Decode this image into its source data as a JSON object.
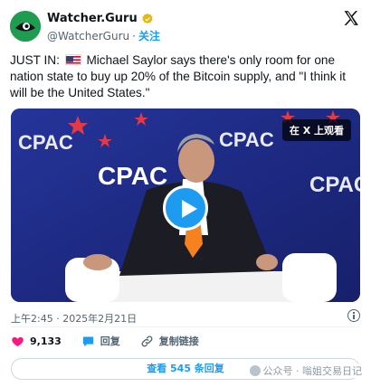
{
  "header": {
    "author_name": "Watcher.Guru",
    "handle": "@WatcherGuru",
    "separator": "·",
    "follow_label": "关注"
  },
  "tweet": {
    "prefix": "JUST IN:",
    "body": "Michael Saylor says there's only room for one nation state to buy up 20% of the Bitcoin supply, and \"I think it will be the United States.\""
  },
  "media": {
    "watch_badge": "在 X 上观看",
    "backdrop_text": "CPAC"
  },
  "meta": {
    "timestamp": "上午2:45 · 2025年2月21日"
  },
  "actions": {
    "like_count": "9,133",
    "reply_label": "回复",
    "copy_link_label": "复制链接"
  },
  "replies_button": "查看 545 条回复",
  "watermark": "公众号 · 嗡姐交易日记",
  "colors": {
    "accent": "#1d9bf0",
    "like": "#f91880",
    "avatar_bg": "#1f9c4f",
    "verified": "#e2b719"
  },
  "icons": {
    "verified": "gold-verified-badge-icon",
    "x_logo": "x-logo-icon",
    "like": "heart-icon",
    "reply": "speech-bubble-icon",
    "copy_link": "link-icon",
    "info": "info-icon",
    "play": "play-icon"
  }
}
